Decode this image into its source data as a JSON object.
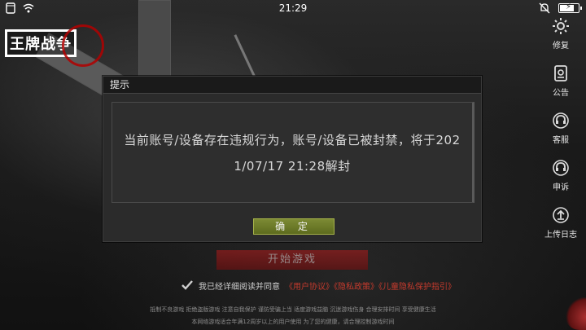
{
  "status_bar": {
    "time": "21:29"
  },
  "logo": {
    "title": "王牌战争",
    "subtitle": ""
  },
  "side_menu": [
    {
      "key": "repair",
      "label": "修复",
      "icon": "gear-icon"
    },
    {
      "key": "notice",
      "label": "公告",
      "icon": "announcement-icon"
    },
    {
      "key": "service",
      "label": "客服",
      "icon": "headset-icon"
    },
    {
      "key": "appeal",
      "label": "申诉",
      "icon": "headset-icon"
    },
    {
      "key": "upload",
      "label": "上传日志",
      "icon": "upload-icon"
    }
  ],
  "dialog": {
    "title": "提示",
    "message_line1": "当前账号/设备存在违规行为，账号/设备已被封禁，将于202",
    "message_line2": "1/07/17 21:28解封",
    "ok_label": "确 定"
  },
  "start_button": {
    "label": "开始游戏"
  },
  "agreement": {
    "prefix": "我已经详细阅读并同意",
    "links": "《用户协议》《隐私政策》《儿童隐私保护指引》",
    "checked": true
  },
  "notice": {
    "line1": "抵制不良游戏 拒绝盗版游戏 注意自我保护 谨防受骗上当 适度游戏益脑 沉迷游戏伤身 合理安排时间 享受健康生活",
    "line2": "本网络游戏适合年满12周岁以上的用户使用    为了您的健康，请合理控制游戏时间"
  },
  "colors": {
    "ok_button": "#6b7a28",
    "start_button": "#a01818",
    "link": "#c43a2d"
  }
}
